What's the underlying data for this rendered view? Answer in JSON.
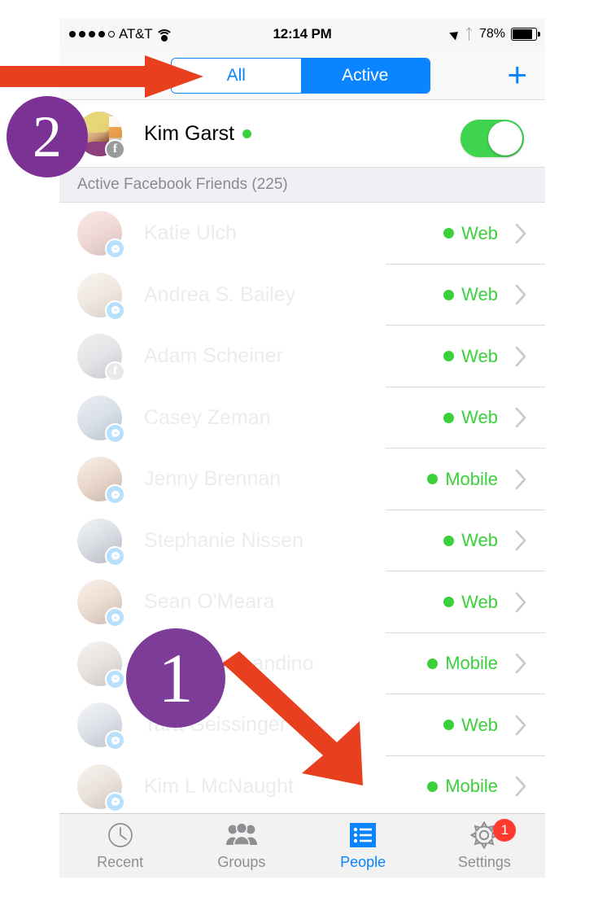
{
  "status_bar": {
    "carrier": "AT&T",
    "signal_dots_filled": 4,
    "signal_dots_total": 5,
    "wifi_icon": "wifi-icon",
    "time": "12:14 PM",
    "location_icon": "location-arrow-icon",
    "bluetooth_icon": "bluetooth-icon",
    "battery_percent": "78%",
    "battery_level": 78
  },
  "navbar": {
    "segments": [
      {
        "label": "All",
        "selected": false
      },
      {
        "label": "Active",
        "selected": true
      }
    ],
    "add_label": "+",
    "accent_color": "#0a84ff"
  },
  "me_row": {
    "name": "Kim Garst",
    "online": true,
    "badge_icon": "facebook-badge-icon",
    "badge_glyph": "f",
    "toggle_on": true,
    "toggle_color": "#3ed44f"
  },
  "section": {
    "header": "Active Facebook Friends (225)",
    "count": 225
  },
  "friends": [
    {
      "name": "Katie Ulch",
      "status": "Web",
      "badge": "messenger-badge-icon"
    },
    {
      "name": "Andrea S. Bailey",
      "status": "Web",
      "badge": "messenger-badge-icon"
    },
    {
      "name": "Adam Scheiner",
      "status": "Web",
      "badge": "facebook-badge-icon"
    },
    {
      "name": "Casey Zeman",
      "status": "Web",
      "badge": "messenger-badge-icon"
    },
    {
      "name": "Jenny Brennan",
      "status": "Mobile",
      "badge": "messenger-badge-icon"
    },
    {
      "name": "Stephanie Nissen",
      "status": "Web",
      "badge": "messenger-badge-icon"
    },
    {
      "name": "Sean O'Meara",
      "status": "Web",
      "badge": "messenger-badge-icon"
    },
    {
      "name": "Antonio M Landino",
      "status": "Mobile",
      "badge": "messenger-badge-icon"
    },
    {
      "name": "Tara Geissinger",
      "status": "Web",
      "badge": "messenger-badge-icon"
    },
    {
      "name": "Kim L McNaught",
      "status": "Mobile",
      "badge": "messenger-badge-icon"
    }
  ],
  "status_color": "#3ad13a",
  "tabs": [
    {
      "label": "Recent",
      "icon": "clock-icon",
      "selected": false,
      "badge": null
    },
    {
      "label": "Groups",
      "icon": "people-icon",
      "selected": false,
      "badge": null
    },
    {
      "label": "People",
      "icon": "list-icon",
      "selected": true,
      "badge": null
    },
    {
      "label": "Settings",
      "icon": "gear-icon",
      "selected": false,
      "badge": "1"
    }
  ],
  "annotations": [
    {
      "number": "1",
      "color": "#7d3c98",
      "arrow_color": "#e8401f",
      "points_to": "people-tab"
    },
    {
      "number": "2",
      "color": "#7b3294",
      "arrow_color": "#e8401f",
      "points_to": "all-segment"
    }
  ]
}
